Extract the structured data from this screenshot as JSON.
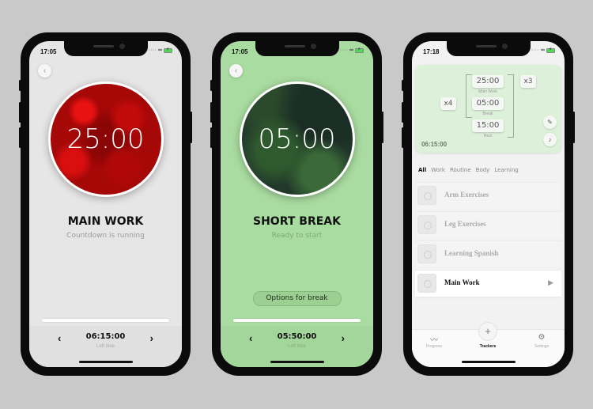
{
  "phones": [
    {
      "status_time": "17:05",
      "timer": "25:00",
      "title": "MAIN WORK",
      "subtitle": "Countdown is running",
      "left_time": "06:15:00",
      "left_time_label": "Left time",
      "progress": 0
    },
    {
      "status_time": "17:05",
      "timer": "05:00",
      "title": "SHORT BREAK",
      "subtitle": "Ready to start",
      "options_button": "Options for break",
      "left_time": "05:50:00",
      "left_time_label": "Left time",
      "progress": 0
    },
    {
      "status_time": "17:18",
      "plan": {
        "outer_repeat": "x4",
        "inner_repeat": "x3",
        "steps": [
          {
            "time": "25:00",
            "label": "Main Work"
          },
          {
            "time": "05:00",
            "label": "Break"
          },
          {
            "time": "15:00",
            "label": "Rest"
          }
        ],
        "total": "06:15:00"
      },
      "filters": [
        "All",
        "Work",
        "Routine",
        "Body",
        "Learning"
      ],
      "active_filter": "All",
      "trackers": [
        {
          "name": "Arm Exercises",
          "active": false
        },
        {
          "name": "Leg Exercises",
          "active": false
        },
        {
          "name": "Learning Spanish",
          "active": false
        },
        {
          "name": "Main Work",
          "active": true
        }
      ],
      "tabs": [
        {
          "label": "Progress",
          "icon": "chart-icon"
        },
        {
          "label": "Trackers",
          "icon": "plus-icon"
        },
        {
          "label": "Settings",
          "icon": "gear-icon"
        }
      ]
    }
  ],
  "icons": {
    "back": "‹",
    "prev": "‹",
    "next": "›",
    "play": "▶",
    "plus": "+",
    "edit": "✎",
    "music": "♪",
    "progress": "〰",
    "settings": "⚙"
  }
}
